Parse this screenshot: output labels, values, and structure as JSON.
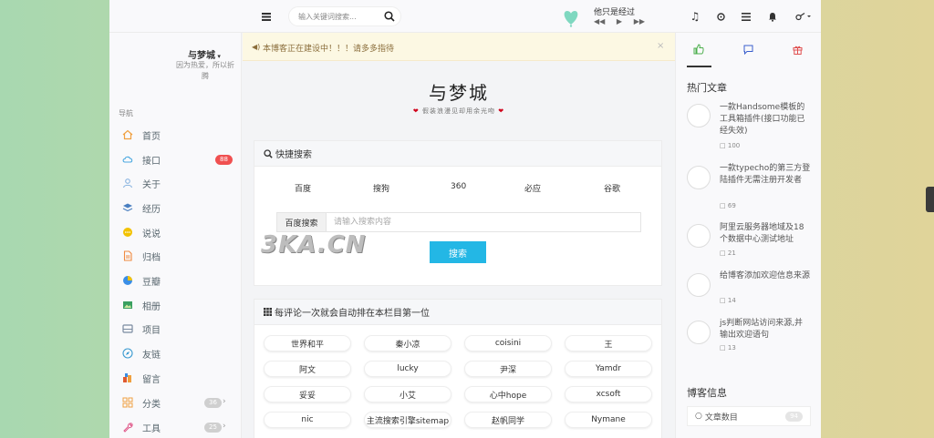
{
  "header": {
    "search_placeholder": "输入关键词搜索...",
    "player_title": "他只是经过"
  },
  "sidebar": {
    "user_name": "与梦城",
    "user_desc": "因为热爱，所以折腾",
    "nav_label": "导航",
    "items": [
      {
        "label": "首页",
        "icon": "home-icon"
      },
      {
        "label": "接口",
        "icon": "cloud-icon",
        "badge": "88"
      },
      {
        "label": "关于",
        "icon": "user-icon"
      },
      {
        "label": "经历",
        "icon": "layers-icon"
      },
      {
        "label": "说说",
        "icon": "chat-icon"
      },
      {
        "label": "归档",
        "icon": "archive-icon"
      },
      {
        "label": "豆瓣",
        "icon": "pie-icon"
      },
      {
        "label": "相册",
        "icon": "image-icon"
      },
      {
        "label": "项目",
        "icon": "drive-icon"
      },
      {
        "label": "友链",
        "icon": "compass-icon"
      },
      {
        "label": "留言",
        "icon": "book-icon"
      },
      {
        "label": "分类",
        "icon": "grid-icon",
        "badge": "36"
      },
      {
        "label": "工具",
        "icon": "wrench-icon",
        "badge": "25"
      }
    ]
  },
  "notice": {
    "text": "本博客正在建设中！！！请多多指待"
  },
  "site": {
    "title": "与梦城",
    "subtitle": "假装浪漫见却用余光吻"
  },
  "quick_search": {
    "title": "快捷搜索",
    "engines": [
      "百度",
      "搜狗",
      "360",
      "必应",
      "谷歌"
    ],
    "addon_label": "百度搜索",
    "input_placeholder": "请输入搜索内容",
    "button_label": "搜索"
  },
  "rank": {
    "title": "每评论一次就会自动排在本栏目第一位",
    "names": [
      "世界和平",
      "秦小凉",
      "coisini",
      "王",
      "阿文",
      "lucky",
      "尹深",
      "Yamdr",
      "妥妥",
      "小艾",
      "心中hope",
      "xcsoft",
      "nic",
      "主流搜索引擎sitemap",
      "赵帆同学",
      "Nymane"
    ]
  },
  "aside": {
    "hot_title": "热门文章",
    "posts": [
      {
        "title": "一款Handsome模板的工具箱插件(接口功能已经失效)",
        "count": "100"
      },
      {
        "title": "一款typecho的第三方登陆插件无需注册开发者",
        "count": "69"
      },
      {
        "title": "阿里云服务器地域及18个数据中心测试地址",
        "count": "21"
      },
      {
        "title": "给博客添加欢迎信息来源",
        "count": "14"
      },
      {
        "title": "js判断网站访问来源,并输出欢迎语句",
        "count": "13"
      }
    ],
    "info_title": "博客信息",
    "info_row_label": "文章数目",
    "info_row_value": "94"
  },
  "watermark": "3KA.CN",
  "colors": {
    "accent": "#23b7e5",
    "badge_red": "#f05050",
    "badge_grey": "#cfcfcf"
  }
}
